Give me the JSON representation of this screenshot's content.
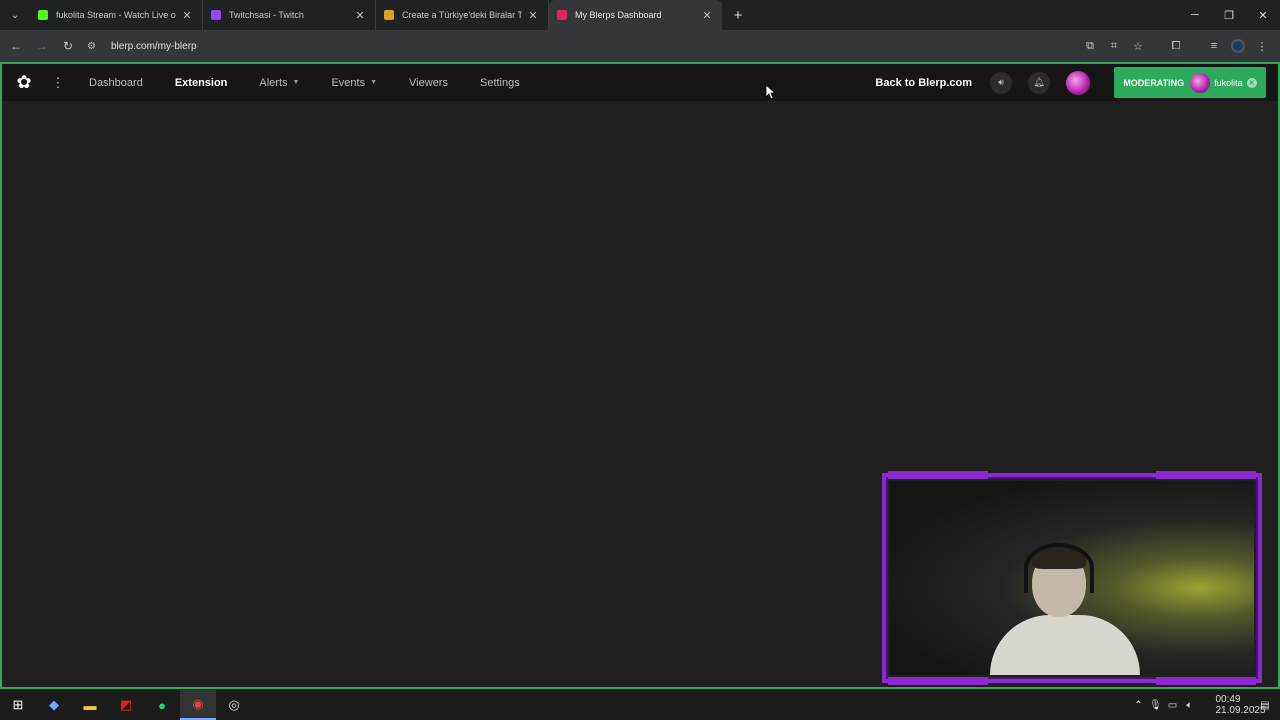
{
  "browser": {
    "tabs": [
      {
        "title": "fukolita Stream - Watch Live on",
        "color": "#53fc18",
        "active": false
      },
      {
        "title": "Twitchsasi - Twitch",
        "color": "#9146ff",
        "active": false
      },
      {
        "title": "Create a Türkiye'deki Biralar Tier",
        "color": "#e0a020",
        "active": false
      },
      {
        "title": "My Blerps Dashboard",
        "color": "#e0245e",
        "active": true
      }
    ],
    "new_tab": "+",
    "url": "blerp.com/my-blerp"
  },
  "app": {
    "nav": {
      "dashboard": "Dashboard",
      "extension": "Extension",
      "alerts": "Alerts",
      "events": "Events",
      "viewers": "Viewers",
      "settings": "Settings"
    },
    "back_link": "Back to Blerp.com",
    "moderating_label": "MODERATING",
    "moderating_user": "fukolita"
  },
  "taskbar": {
    "time": "00:49",
    "date": "21.09.2025"
  }
}
